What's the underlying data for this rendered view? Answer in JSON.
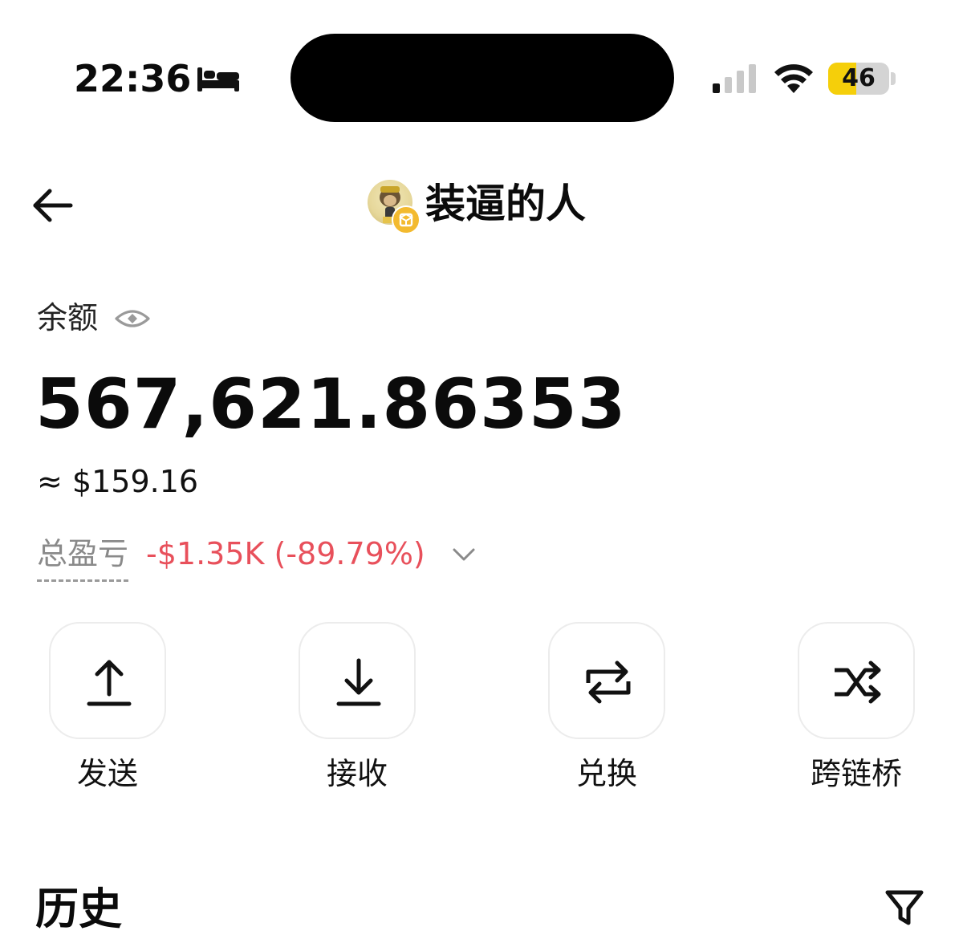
{
  "status_bar": {
    "time": "22:36",
    "battery_level": "46",
    "battery_fraction": 0.46,
    "sleep_icon": "bed-icon",
    "signal_icon": "cellular-signal-icon",
    "wifi_icon": "wifi-icon",
    "battery_color": "#f5cf0a"
  },
  "header": {
    "back_icon": "arrow-left-icon",
    "wallet_name": "装逼的人",
    "chain_badge_icon": "bnb-chain-icon",
    "chain_badge_color": "#f3ba2f"
  },
  "balance": {
    "label": "余额",
    "visibility_icon": "eye-icon",
    "amount": "567,621.86353",
    "fiat_value": "≈ $159.16",
    "pnl_label": "总盈亏",
    "pnl_value": "-$1.35K (-89.79%)",
    "pnl_color": "#e8505b",
    "pnl_toggle_icon": "chevron-down-icon"
  },
  "actions": [
    {
      "label": "发送",
      "icon": "upload-icon"
    },
    {
      "label": "接收",
      "icon": "download-icon"
    },
    {
      "label": "兑换",
      "icon": "swap-arrows-icon"
    },
    {
      "label": "跨链桥",
      "icon": "shuffle-icon"
    }
  ],
  "history": {
    "title": "历史",
    "filter_icon": "filter-icon"
  }
}
